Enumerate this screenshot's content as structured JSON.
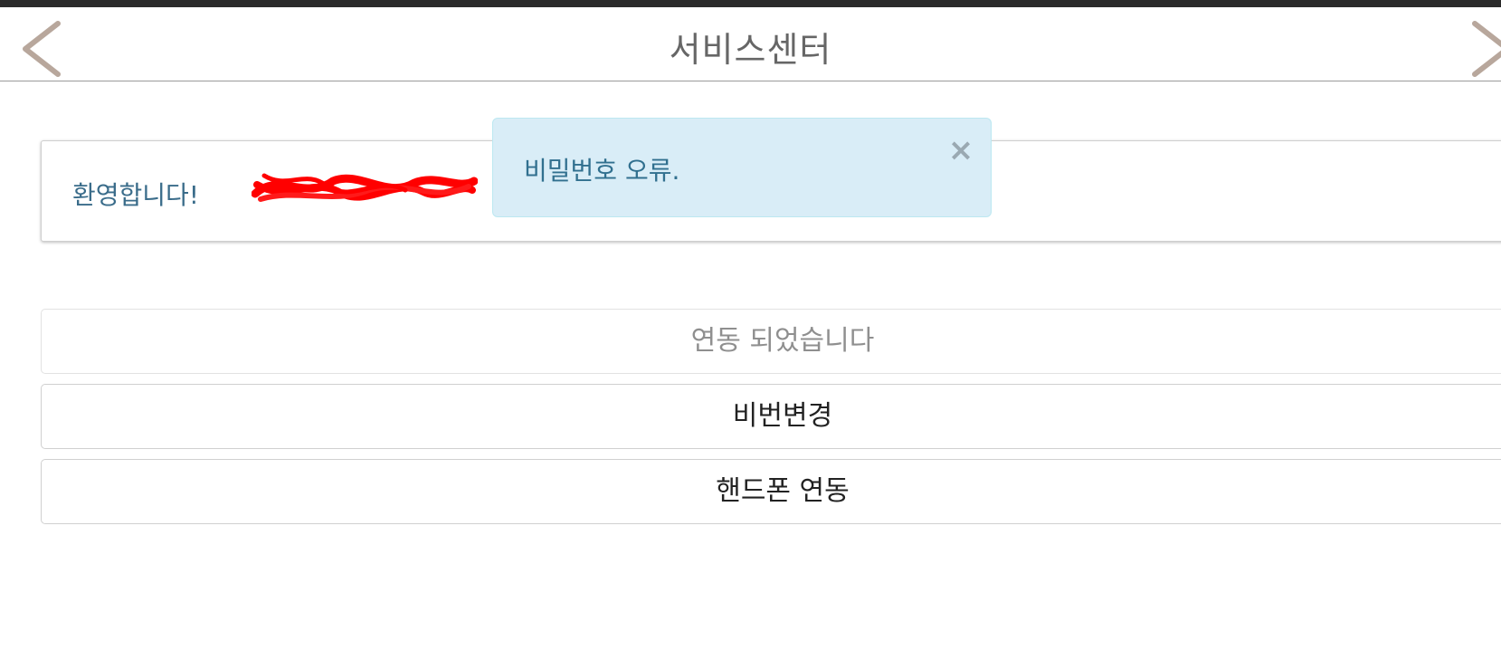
{
  "header": {
    "title": "서비스센터",
    "back_icon": "chevron-left-icon",
    "forward_icon": "chevron-right-icon"
  },
  "welcome": {
    "text": "환영합니다!"
  },
  "alert": {
    "message": "비밀번호 오류.",
    "close_label": "×"
  },
  "buttons": {
    "status_label": "연동 되었습니다",
    "change_password_label": "비번변경",
    "phone_link_label": "핸드폰 연동"
  },
  "colors": {
    "alert_bg": "#d9edf7",
    "alert_text": "#31708f",
    "welcome_text": "#3a6c8a",
    "nav_chevron": "#b8a79c"
  }
}
